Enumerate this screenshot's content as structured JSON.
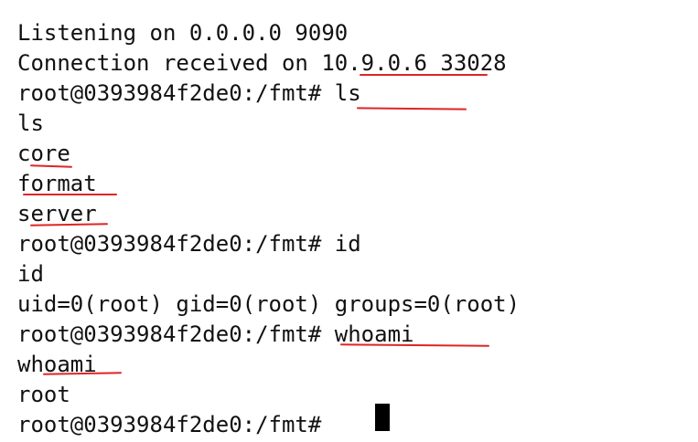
{
  "terminal": {
    "lines": [
      "Listening on 0.0.0.0 9090",
      "Connection received on 10.9.0.6 33028",
      "root@0393984f2de0:/fmt# ls",
      "ls",
      "core",
      "format",
      "server",
      "root@0393984f2de0:/fmt# id",
      "id",
      "uid=0(root) gid=0(root) groups=0(root)",
      "root@0393984f2de0:/fmt# whoami",
      "whoami",
      "root",
      "root@0393984f2de0:/fmt# "
    ],
    "cursor_visible": true
  },
  "colors": {
    "background": "#ffffff",
    "text": "#111111",
    "annotation": "#e02424",
    "cursor": "#000000"
  }
}
